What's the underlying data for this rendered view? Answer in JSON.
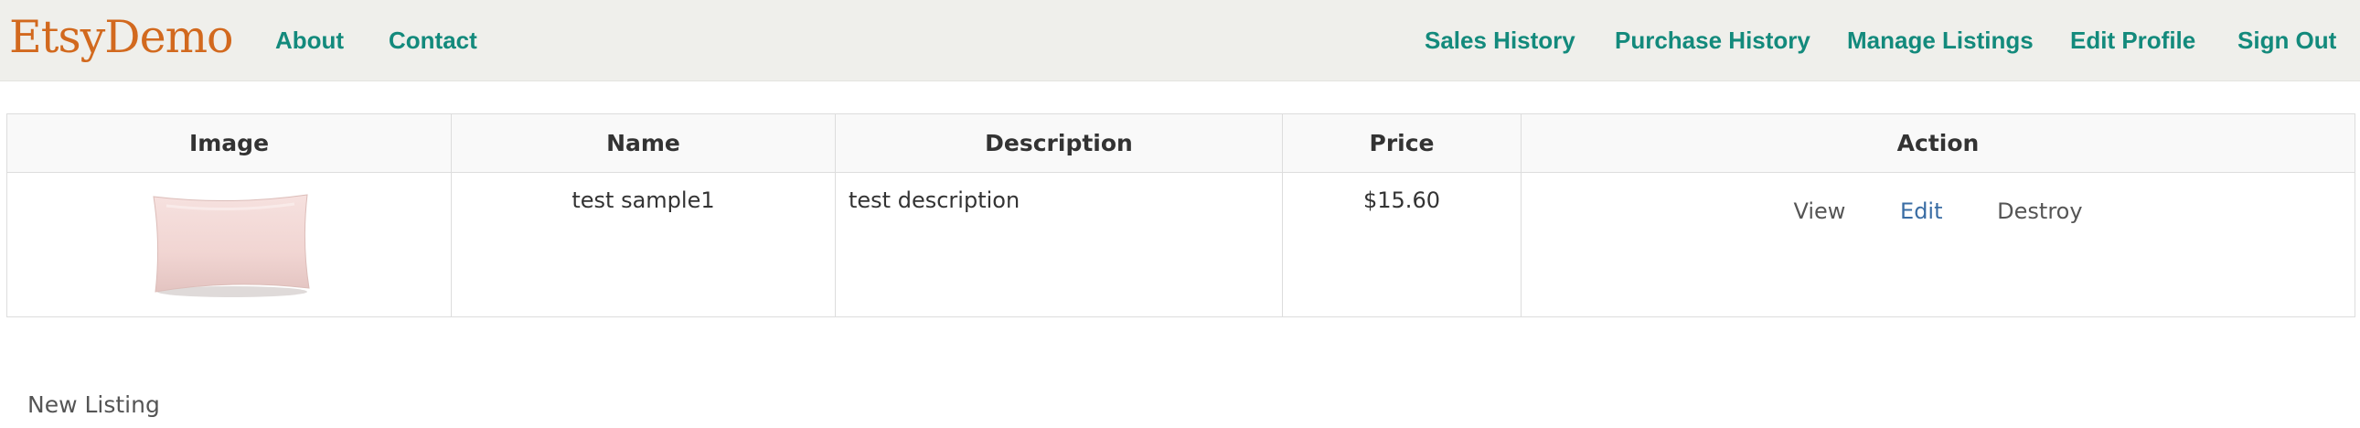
{
  "navbar": {
    "brand": "EtsyDemo",
    "left_links": [
      "About",
      "Contact"
    ],
    "right_links": [
      "Sales History",
      "Purchase History",
      "Manage Listings",
      "Edit Profile",
      "Sign Out"
    ]
  },
  "table": {
    "headers": [
      "Image",
      "Name",
      "Description",
      "Price",
      "Action"
    ],
    "rows": [
      {
        "image": "pillow-image",
        "name": "test sample1",
        "description": "test description",
        "price": "$15.60",
        "actions": [
          "View",
          "Edit",
          "Destroy"
        ]
      }
    ]
  },
  "footer": {
    "new_listing": "New Listing"
  },
  "colors": {
    "brand": "#d2691e",
    "nav_link": "#138a7c",
    "edit_link": "#3a6da4",
    "navbar_bg": "#efefeb"
  }
}
